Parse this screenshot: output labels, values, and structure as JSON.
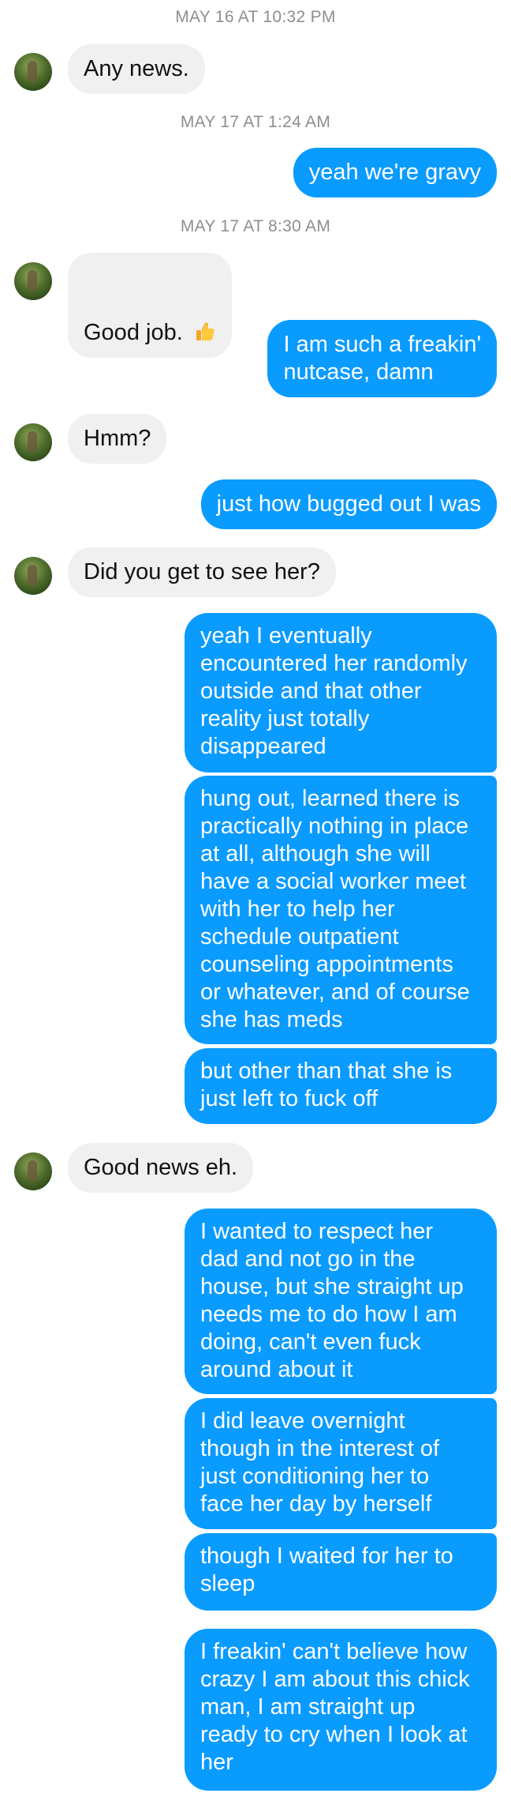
{
  "conversation": {
    "timestamps": [
      "MAY 16 AT 10:32 PM",
      "MAY 17 AT 1:24 AM",
      "MAY 17 AT 8:30 AM"
    ],
    "messages": [
      {
        "from": "them",
        "text": "Any news."
      },
      {
        "from": "me",
        "text": "yeah we're gravy"
      },
      {
        "from": "them",
        "text": "Good job. "
      },
      {
        "from": "me",
        "text": "I am such a freakin'\nnutcase, damn"
      },
      {
        "from": "them",
        "text": "Hmm?"
      },
      {
        "from": "me",
        "text": "just how bugged out I was"
      },
      {
        "from": "them",
        "text": "Did you get to see her?"
      },
      {
        "from": "me",
        "text": "yeah I eventually\nencountered her randomly\noutside and that other\nreality just totally\ndisappeared"
      },
      {
        "from": "me",
        "text": "hung out, learned there is\npractically nothing in place\nat all, although she will\nhave a social worker meet\nwith her to help her\nschedule outpatient\ncounseling appointments\nor whatever, and of course\nshe has meds"
      },
      {
        "from": "me",
        "text": "but other than that she is\njust left to fuck off"
      },
      {
        "from": "them",
        "text": "Good news eh."
      },
      {
        "from": "me",
        "text": "I wanted to respect her\ndad and not go in the\nhouse, but she straight up\nneeds me to do how I am\ndoing, can't even fuck\naround about it"
      },
      {
        "from": "me",
        "text": "I did leave overnight\nthough in the interest of\njust conditioning her to\nface her day by herself"
      },
      {
        "from": "me",
        "text": "though I waited for her to\nsleep"
      },
      {
        "from": "me",
        "text": "I freakin' can't believe how\ncrazy I am about this chick\nman, I am straight up\nready to cry when I look at\nher"
      }
    ]
  },
  "colors": {
    "outgoing_bubble": "#0a9bff",
    "incoming_bubble": "#f0f0f0",
    "timestamp_text": "#8e8e93"
  },
  "icons": {
    "thumbs_up": "thumbs-up-emoji"
  }
}
